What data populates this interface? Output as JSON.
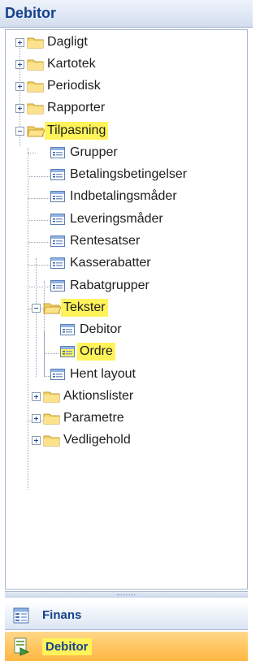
{
  "header": {
    "title": "Debitor"
  },
  "tree": {
    "dagligt": "Dagligt",
    "kartotek": "Kartotek",
    "periodisk": "Periodisk",
    "rapporter": "Rapporter",
    "tilpasning": "Tilpasning",
    "grupper": "Grupper",
    "betalingsbetingelser": "Betalingsbetingelser",
    "indbetalingsmaader": "Indbetalingsmåder",
    "leveringsmaader": "Leveringsmåder",
    "rentesatser": "Rentesatser",
    "kasserabatter": "Kasserabatter",
    "rabatgrupper": "Rabatgrupper",
    "tekster": "Tekster",
    "debitor": "Debitor",
    "ordre": "Ordre",
    "hent_layout": "Hent layout",
    "aktionslister": "Aktionslister",
    "parametre": "Parametre",
    "vedligehold": "Vedligehold"
  },
  "nav": {
    "finans": "Finans",
    "debitor": "Debitor"
  },
  "icons": {
    "folder": "folder-icon",
    "form": "form-icon",
    "expand": "plus-icon",
    "collapse": "minus-icon"
  }
}
